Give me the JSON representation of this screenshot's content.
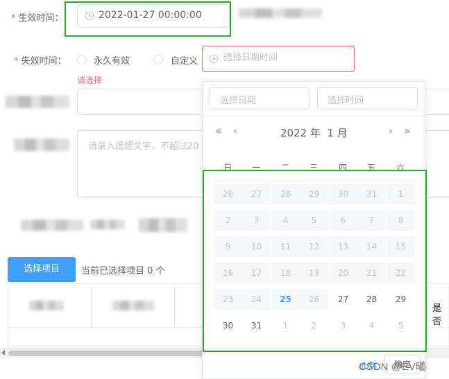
{
  "form": {
    "effective_label": "生效时间：",
    "effective_value": "2022-01-27 00:00:00",
    "expire_label": "失效时间：",
    "radio_permanent": "永久有效",
    "radio_custom": "自定义",
    "expire_placeholder": "选择日期时间",
    "expire_error": "请选择",
    "reminder_placeholder": "请录入提醒文字，不超过20"
  },
  "project": {
    "select_button": "选择项目",
    "selected_count_text": "当前已选择项目 0 个",
    "right_header_partial": "是否"
  },
  "picker": {
    "date_placeholder": "选择日期",
    "time_placeholder": "选择时间",
    "prev_year": "«",
    "prev_month": "‹",
    "next_month": "›",
    "next_year": "»",
    "header": "2022 年  1 月",
    "weekdays": [
      "日",
      "一",
      "二",
      "三",
      "四",
      "五",
      "六"
    ],
    "footer_now": "此刻",
    "footer_confirm": "确定",
    "weeks": [
      [
        {
          "d": "26",
          "s": "dis"
        },
        {
          "d": "27",
          "s": "dis"
        },
        {
          "d": "28",
          "s": "dis"
        },
        {
          "d": "29",
          "s": "dis"
        },
        {
          "d": "30",
          "s": "dis"
        },
        {
          "d": "31",
          "s": "dis"
        },
        {
          "d": "1",
          "s": "dis"
        }
      ],
      [
        {
          "d": "2",
          "s": "dis"
        },
        {
          "d": "3",
          "s": "dis"
        },
        {
          "d": "4",
          "s": "dis"
        },
        {
          "d": "5",
          "s": "dis"
        },
        {
          "d": "6",
          "s": "dis"
        },
        {
          "d": "7",
          "s": "dis"
        },
        {
          "d": "8",
          "s": "dis"
        }
      ],
      [
        {
          "d": "9",
          "s": "dis"
        },
        {
          "d": "10",
          "s": "dis"
        },
        {
          "d": "11",
          "s": "dis"
        },
        {
          "d": "12",
          "s": "dis"
        },
        {
          "d": "13",
          "s": "dis"
        },
        {
          "d": "14",
          "s": "dis"
        },
        {
          "d": "15",
          "s": "dis"
        }
      ],
      [
        {
          "d": "16",
          "s": "dis"
        },
        {
          "d": "17",
          "s": "dis"
        },
        {
          "d": "18",
          "s": "dis"
        },
        {
          "d": "19",
          "s": "dis"
        },
        {
          "d": "20",
          "s": "dis"
        },
        {
          "d": "21",
          "s": "dis"
        },
        {
          "d": "22",
          "s": "dis"
        }
      ],
      [
        {
          "d": "23",
          "s": "dis"
        },
        {
          "d": "24",
          "s": "dis"
        },
        {
          "d": "25",
          "s": "today"
        },
        {
          "d": "26",
          "s": "dis"
        },
        {
          "d": "27",
          "s": "on"
        },
        {
          "d": "28",
          "s": "on"
        },
        {
          "d": "29",
          "s": "on"
        }
      ],
      [
        {
          "d": "30",
          "s": "on"
        },
        {
          "d": "31",
          "s": "on"
        },
        {
          "d": "1",
          "s": "next"
        },
        {
          "d": "2",
          "s": "next"
        },
        {
          "d": "3",
          "s": "next"
        },
        {
          "d": "4",
          "s": "next"
        },
        {
          "d": "5",
          "s": "next"
        }
      ]
    ]
  },
  "watermark": "CSDN @EV曦"
}
